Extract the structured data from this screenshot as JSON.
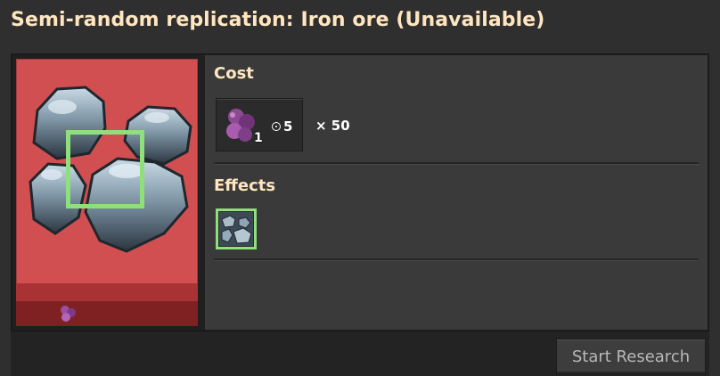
{
  "window": {
    "title": "Semi-random replication: Iron ore (Unavailable)"
  },
  "tech_card": {
    "icon": "iron-ore-icon",
    "cost_pack_icon": "science-pack-icon",
    "background_color": "#d14f50"
  },
  "cost": {
    "heading": "Cost",
    "item_icon": "science-pack-icon",
    "item_count": "1",
    "time_icon": "clock-icon",
    "time_value": "5",
    "multiplier_text": "× 50"
  },
  "effects": {
    "heading": "Effects",
    "items": [
      {
        "icon": "iron-ore-icon"
      }
    ]
  },
  "footer": {
    "start_research_label": "Start Research"
  },
  "colors": {
    "heading": "#ffe6c0",
    "highlight": "#8ee07a",
    "panel": "#3a3a3a"
  }
}
